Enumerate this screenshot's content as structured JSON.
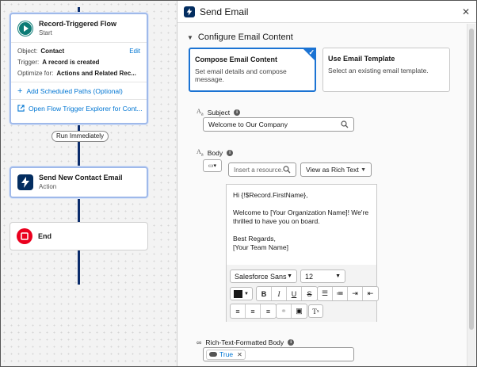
{
  "canvas": {
    "start_card": {
      "title": "Record-Triggered Flow",
      "subtitle": "Start",
      "edit_label": "Edit",
      "object_key": "Object:",
      "object_value": "Contact",
      "trigger_key": "Trigger:",
      "trigger_value": "A record is created",
      "optimize_key": "Optimize for:",
      "optimize_value": "Actions and Related Rec...",
      "scheduled_paths_link": "Add Scheduled Paths (Optional)",
      "explorer_link": "Open Flow Trigger Explorer for Cont..."
    },
    "path_label": "Run Immediately",
    "action_card": {
      "title": "Send New Contact Email",
      "subtitle": "Action"
    },
    "end_card": {
      "title": "End"
    }
  },
  "panel": {
    "title": "Send Email",
    "section_title": "Configure Email Content",
    "compose_tile": {
      "title": "Compose Email Content",
      "description": "Set email details and compose message."
    },
    "template_tile": {
      "title": "Use Email Template",
      "description": "Select an existing email template."
    },
    "subject": {
      "label": "Subject",
      "value": "Welcome to Our Company"
    },
    "body": {
      "label": "Body",
      "resource_placeholder": "Insert a resource...",
      "view_mode": "View as Rich Text",
      "greeting": "Hi {!$Record.FirstName},",
      "paragraph": "Welcome to [Your Organization Name]! We're thrilled to have you on board.",
      "signoff": "Best Regards,",
      "signature": "[Your Team Name]",
      "font_family": "Salesforce Sans",
      "font_size": "12"
    },
    "rich_text_body": {
      "label": "Rich-Text-Formatted Body",
      "value": "True"
    }
  },
  "colors": {
    "accent": "#0176d3",
    "flow_line": "#0b2c6b",
    "start_icon": "#0b7b75",
    "action_icon": "#032d60",
    "end_icon": "#ea001e",
    "selected_border": "#1b73d3"
  },
  "icons": [
    "play-icon",
    "plus-icon",
    "external-link-icon",
    "lightning-icon",
    "stop-icon",
    "chevron-down-icon",
    "close-icon",
    "search-icon",
    "info-icon",
    "merge-field-icon",
    "bold-icon",
    "italic-icon",
    "underline-icon",
    "strikethrough-icon",
    "bullet-list-icon",
    "numbered-list-icon",
    "indent-icon",
    "outdent-icon",
    "align-left-icon",
    "align-center-icon",
    "align-right-icon",
    "link-icon",
    "image-icon",
    "clear-formatting-icon",
    "text-color-icon"
  ]
}
